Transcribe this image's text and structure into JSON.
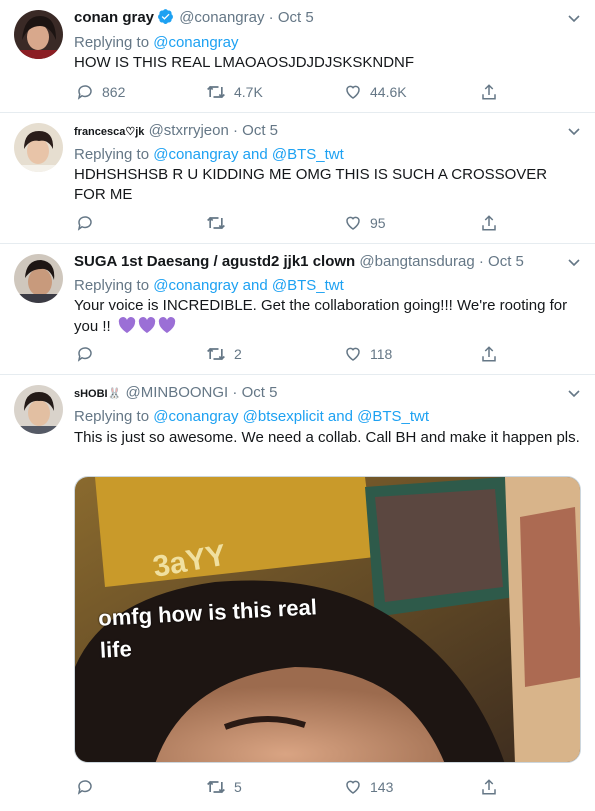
{
  "tweets": [
    {
      "name": "conan gray",
      "verified": true,
      "handle": "@conangray",
      "date": "Oct 5",
      "reply_prefix": "Replying to",
      "reply_mentions": "@conangray",
      "text": "HOW IS THIS REAL LMAOAOSJDJDJSKSKNDNF",
      "replies": "862",
      "retweets": "4.7K",
      "likes": "44.6K"
    },
    {
      "name": "francesca♡jk",
      "handle": "@stxrryjeon",
      "date": "Oct 5",
      "reply_prefix": "Replying to",
      "reply_mentions": "@conangray and @BTS_twt",
      "text": "HDHSHSHSB R U KIDDING ME OMG THIS IS SUCH A CROSSOVER FOR ME",
      "replies": "",
      "retweets": "",
      "likes": "95"
    },
    {
      "name": "SUGA 1st Daesang / agustd2 jjk1 clown",
      "handle": "@bangtansdurag",
      "date": "Oct 5",
      "reply_prefix": "Replying to",
      "reply_mentions": "@conangray and @BTS_twt",
      "text": "Your voice is INCREDIBLE. Get the collaboration going!!! We're rooting for you !!",
      "replies": "",
      "retweets": "2",
      "likes": "118"
    },
    {
      "name": "sHOBI🐰",
      "handle": "@MINBOONGI",
      "date": "Oct 5",
      "reply_prefix": "Replying to",
      "reply_mentions": "@conangray @btsexplicit and @BTS_twt",
      "text": "This is just so awesome. We need a collab. Call BH and make it happen pls.",
      "media_caption": "omfg how is this real life",
      "replies": "",
      "retweets": "5",
      "likes": "143"
    }
  ],
  "colors": {
    "accent": "#1da1f2",
    "muted": "#657786",
    "heart_emoji": "#9b6fd6"
  },
  "icons": [
    "reply-icon",
    "retweet-icon",
    "like-icon",
    "share-icon",
    "caret-down-icon",
    "verified-badge-icon"
  ]
}
